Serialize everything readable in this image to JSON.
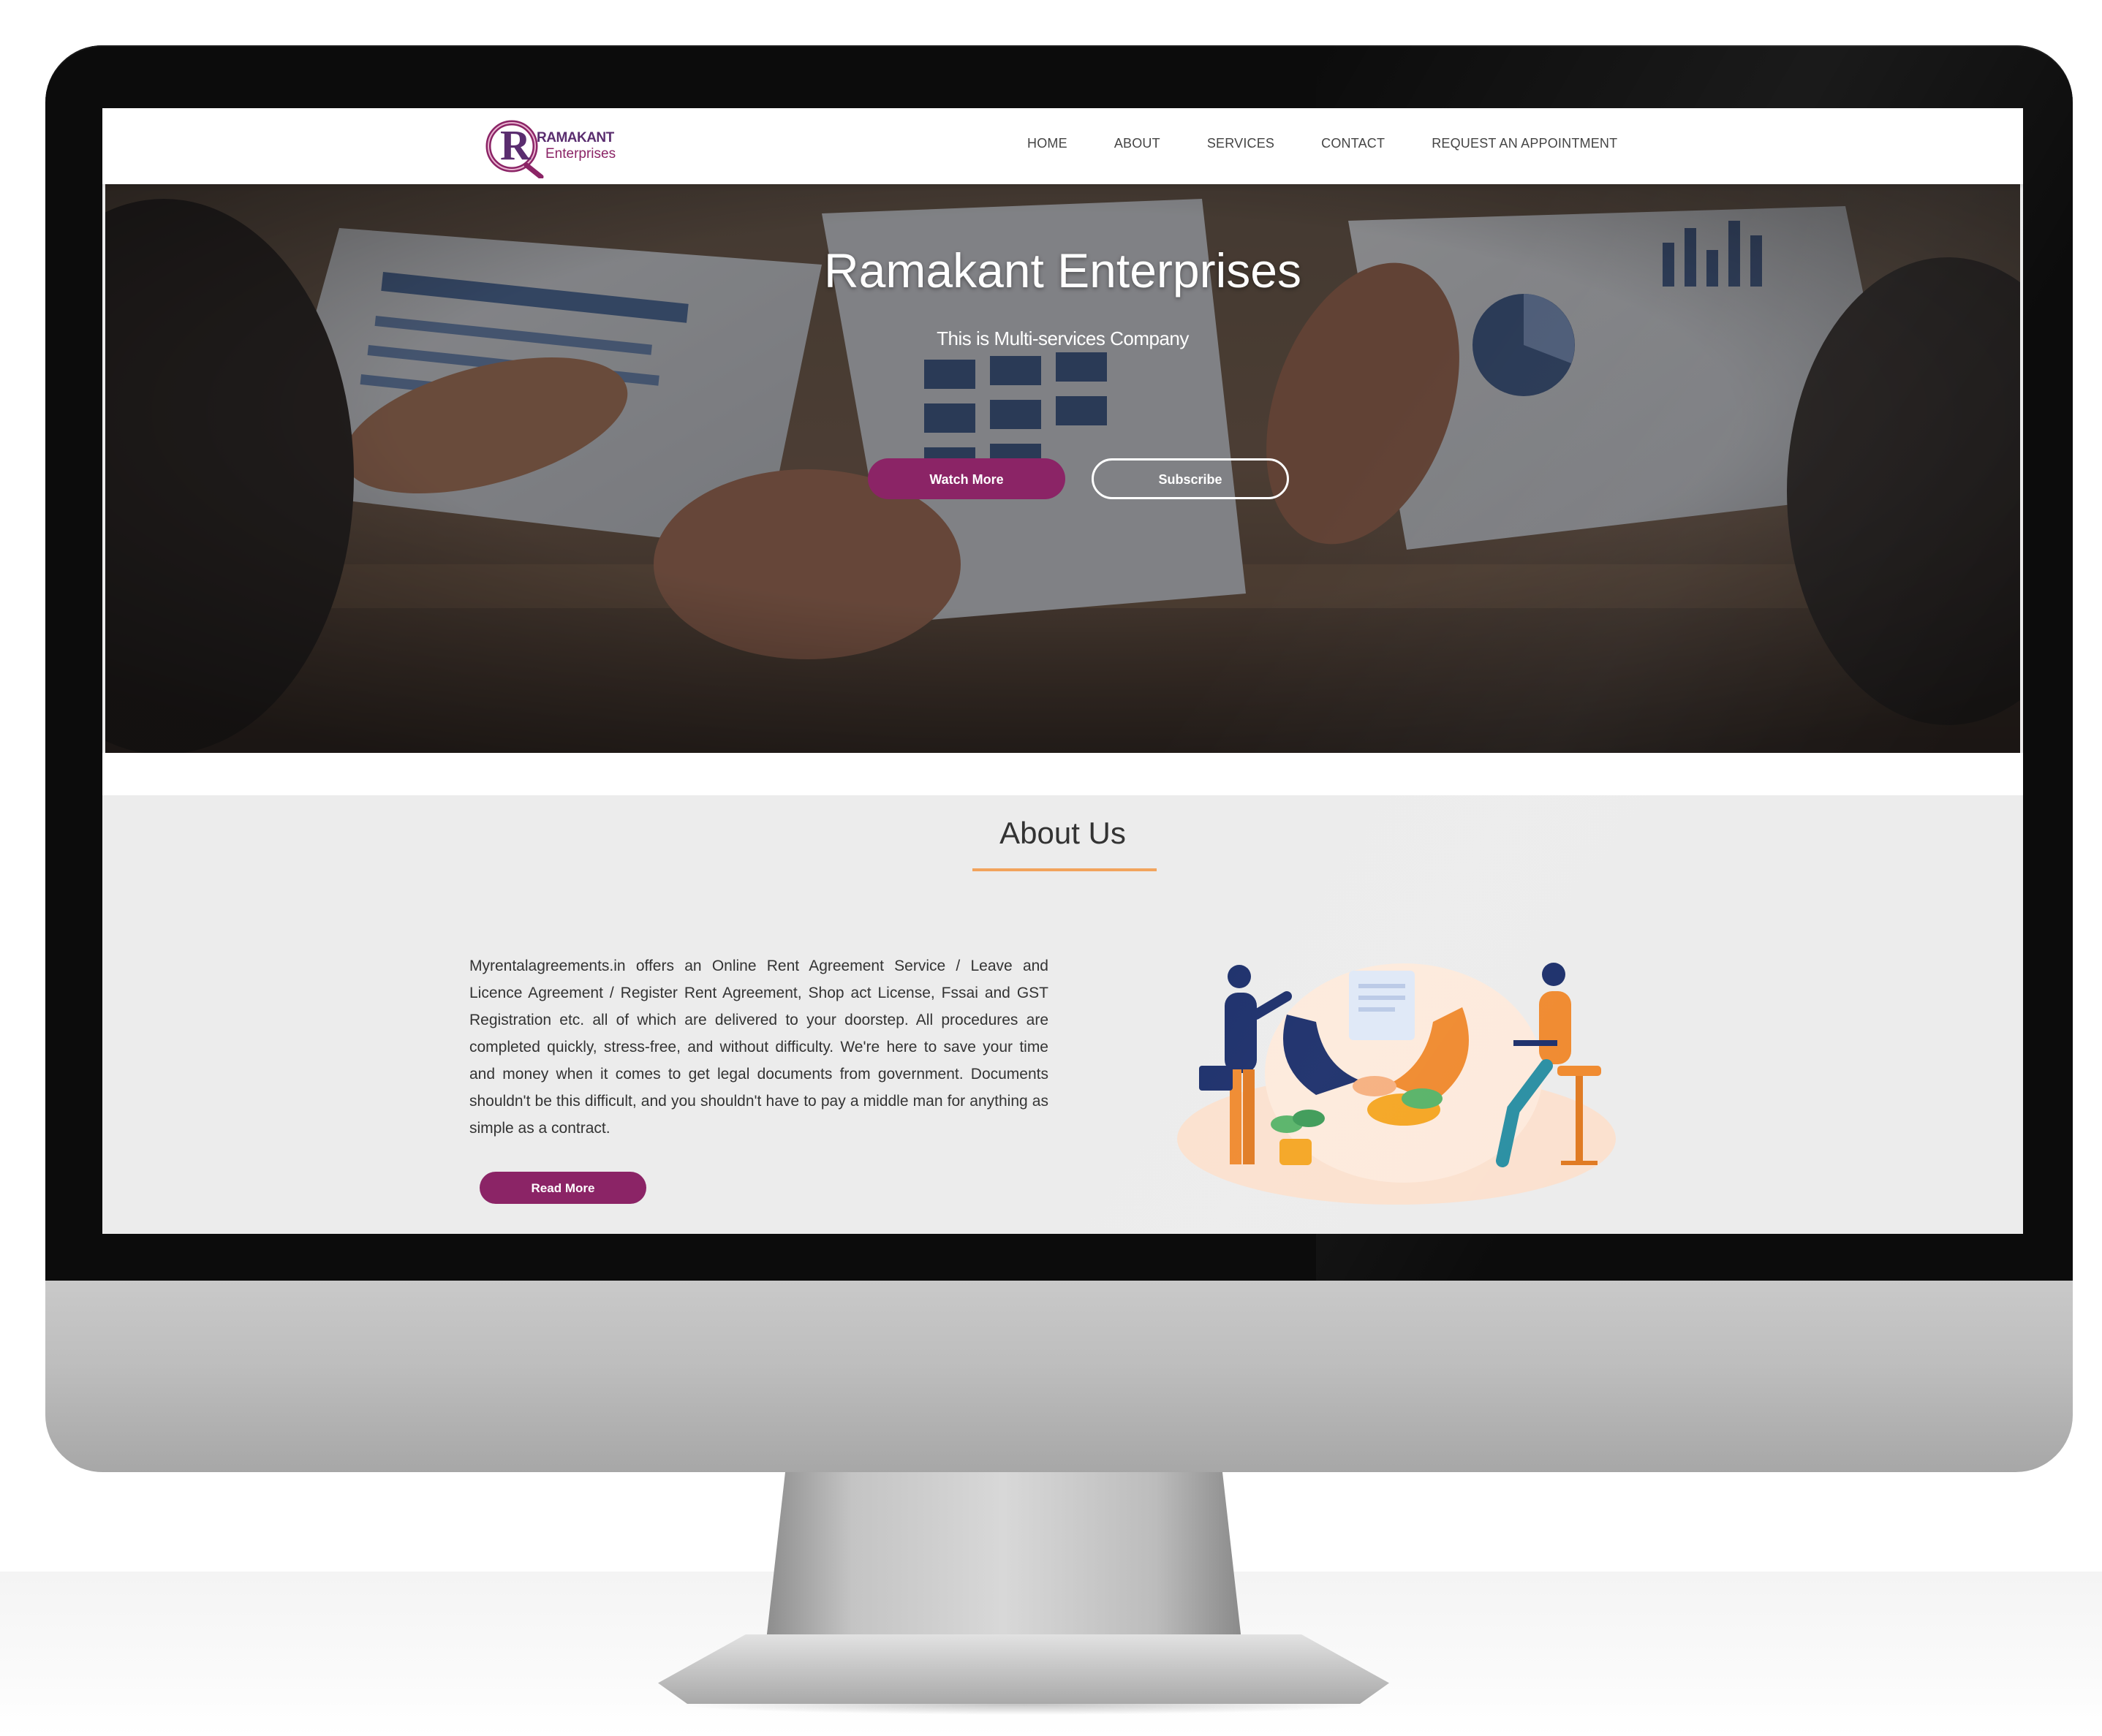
{
  "brand": {
    "logo_letter": "R",
    "logo_line1": "RAMAKANT",
    "logo_line2": "Enterprises",
    "primary_color": "#8b2466",
    "accent_color": "#f2a35c"
  },
  "nav": {
    "items": [
      {
        "label": "HOME"
      },
      {
        "label": "ABOUT"
      },
      {
        "label": "SERVICES"
      },
      {
        "label": "CONTACT"
      },
      {
        "label": "REQUEST AN APPOINTMENT"
      }
    ]
  },
  "hero": {
    "title": "Ramakant Enterprises",
    "subtitle": "This is Multi-services Company",
    "watch_label": "Watch More",
    "subscribe_label": "Subscribe",
    "background_image": "business-meeting-documents-photo"
  },
  "about": {
    "title": "About Us",
    "body": "Myrentalagreements.in offers an Online Rent Agreement Service / Leave and Licence Agreement / Register Rent Agreement, Shop act License, Fssai and GST Registration etc. all of which are delivered to your doorstep. All procedures are completed quickly, stress-free, and without difficulty. We're here to save your time and money when it comes to get legal documents from government. Documents shouldn't be this difficult, and you shouldn't have to pay a middle man for anything as simple as a contract.",
    "read_more_label": "Read More",
    "illustration": "business-handshake-illustration"
  }
}
